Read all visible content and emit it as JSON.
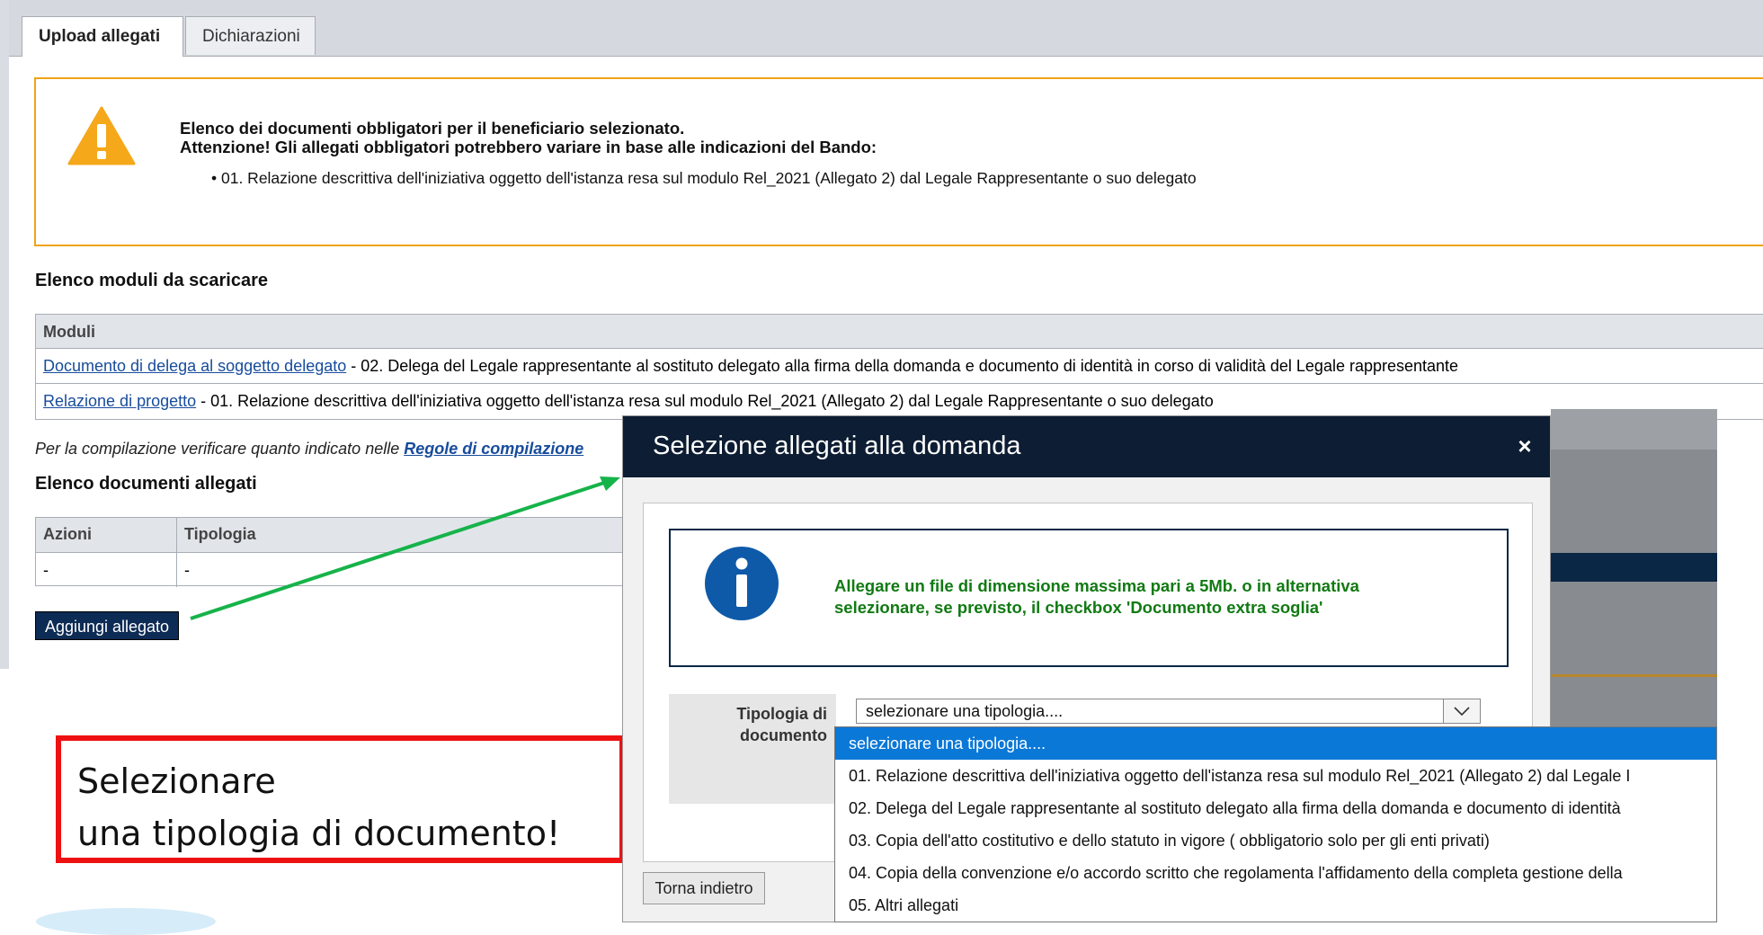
{
  "tabs": {
    "upload": "Upload allegati",
    "dichiarazioni": "Dichiarazioni"
  },
  "warning": {
    "line1": "Elenco dei documenti obbligatori per il beneficiario selezionato.",
    "line2": "Attenzione! Gli allegati obbligatori potrebbero variare in base alle indicazioni del Bando:",
    "bullet": "• 01. Relazione descrittiva dell'iniziativa oggetto dell'istanza resa sul modulo Rel_2021 (Allegato 2) dal Legale Rappresentante o suo delegato"
  },
  "moduli": {
    "section_title": "Elenco moduli da scaricare",
    "header": "Moduli",
    "rows": [
      {
        "link": "Documento di delega al soggetto delegato",
        "text": " - 02. Delega del Legale rappresentante al sostituto delegato alla firma della domanda e documento di identità in corso di validità del Legale rappresentante"
      },
      {
        "link": "Relazione di progetto",
        "text": " - 01. Relazione descrittiva dell'iniziativa oggetto dell'istanza resa sul modulo Rel_2021 (Allegato 2) dal Legale Rappresentante o suo delegato"
      }
    ]
  },
  "note": {
    "text": "Per la compilazione verificare quanto indicato nelle ",
    "link": "Regole di compilazione"
  },
  "documenti": {
    "section_title": "Elenco documenti allegati",
    "col_azioni": "Azioni",
    "col_tipologia": "Tipologia",
    "val_azioni": "-",
    "val_tipologia": "-"
  },
  "add_button": "Aggiungi allegato",
  "callout": {
    "line1": "Selezionare",
    "line2": "una tipologia di documento!"
  },
  "modal": {
    "title": "Selezione allegati alla domanda",
    "close": "×",
    "info_line1": "Allegare un file di dimensione massima pari a 5Mb. o in alternativa",
    "info_line2": "selezionare, se previsto, il checkbox 'Documento extra soglia'",
    "field_label_1": "Tipologia di",
    "field_label_2": "documento",
    "select_value": "selezionare una tipologia....",
    "back_button": "Torna indietro"
  },
  "dropdown": {
    "options": [
      "selezionare una tipologia....",
      "01. Relazione descrittiva dell'iniziativa oggetto dell'istanza resa sul modulo Rel_2021 (Allegato 2) dal Legale I",
      "02. Delega del Legale rappresentante al sostituto delegato alla firma della domanda e documento di identità",
      "03. Copia dell'atto costitutivo e dello statuto in vigore ( obbligatorio solo per gli enti privati)",
      "04. Copia della convenzione e/o accordo scritto che regolamenta l'affidamento della completa gestione della",
      "05. Altri allegati"
    ]
  },
  "colors": {
    "warning_border": "#f0a315",
    "nav_dark": "#0d1d33",
    "info_text": "#117a13",
    "link": "#174c9c",
    "arrow": "#16b34a",
    "callout_border": "#ee1111",
    "dropdown_selected": "#0a78d7"
  }
}
